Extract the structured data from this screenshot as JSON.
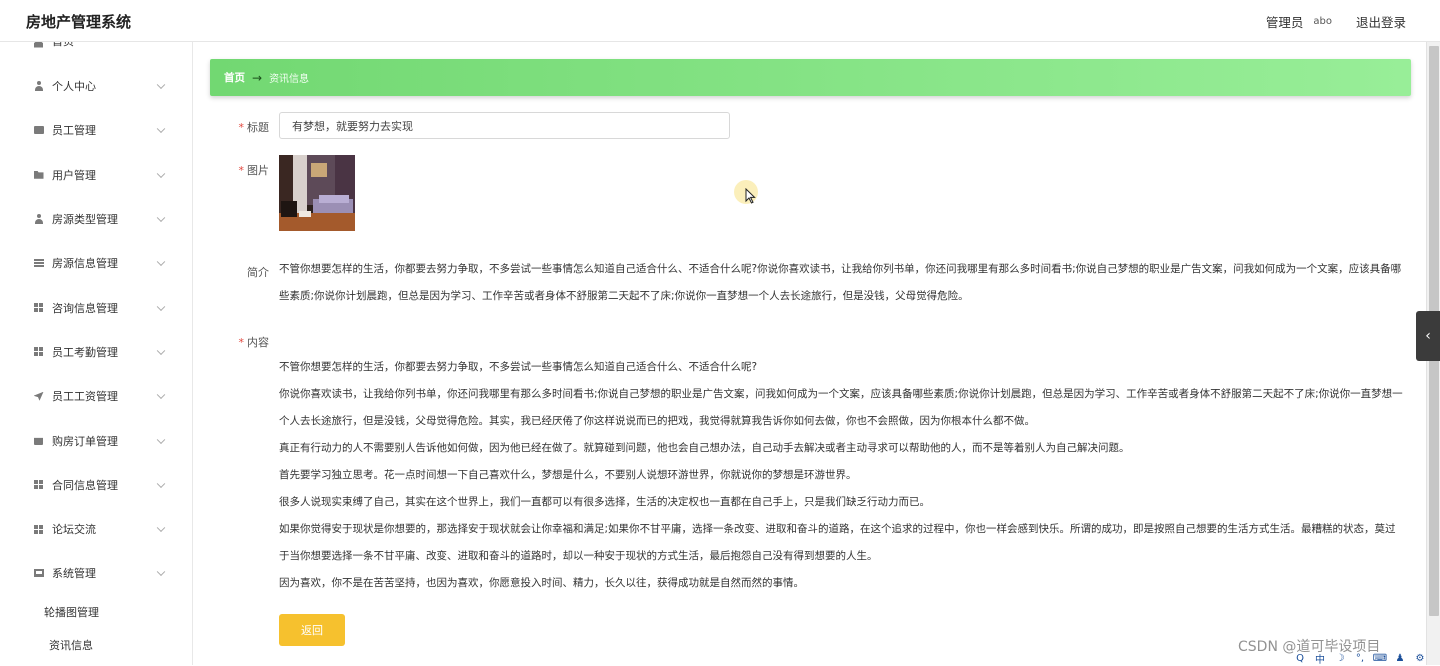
{
  "header": {
    "app_title": "房地产管理系统",
    "role": "管理员",
    "username": "abo",
    "logout_label": "退出登录"
  },
  "sidebar": {
    "items": [
      {
        "label": "首页",
        "icon": "home-icon"
      },
      {
        "label": "个人中心",
        "icon": "user-icon"
      },
      {
        "label": "员工管理",
        "icon": "chat-icon"
      },
      {
        "label": "用户管理",
        "icon": "folder-icon"
      },
      {
        "label": "房源类型管理",
        "icon": "user-icon"
      },
      {
        "label": "房源信息管理",
        "icon": "list-icon"
      },
      {
        "label": "咨询信息管理",
        "icon": "grid-icon"
      },
      {
        "label": "员工考勤管理",
        "icon": "grid-icon"
      },
      {
        "label": "员工工资管理",
        "icon": "send-icon"
      },
      {
        "label": "购房订单管理",
        "icon": "bag-icon"
      },
      {
        "label": "合同信息管理",
        "icon": "grid-icon"
      },
      {
        "label": "论坛交流",
        "icon": "grid-icon"
      },
      {
        "label": "系统管理",
        "icon": "monitor-icon"
      }
    ],
    "sub_items": [
      "轮播图管理",
      "资讯信息"
    ]
  },
  "breadcrumb": {
    "home": "首页",
    "arrow": "→",
    "current": "资讯信息"
  },
  "form": {
    "title_label": "标题",
    "title_value": "有梦想，就要努力去实现",
    "image_label": "图片",
    "intro_label": "简介",
    "intro_text": "不管你想要怎样的生活，你都要去努力争取，不多尝试一些事情怎么知道自己适合什么、不适合什么呢?你说你喜欢读书，让我给你列书单，你还问我哪里有那么多时间看书;你说自己梦想的职业是广告文案，问我如何成为一个文案，应该具备哪些素质;你说你计划晨跑，但总是因为学习、工作辛苦或者身体不舒服第二天起不了床;你说你一直梦想一个人去长途旅行，但是没钱，父母觉得危险。",
    "content_label": "内容",
    "content_paragraphs": [
      "不管你想要怎样的生活，你都要去努力争取，不多尝试一些事情怎么知道自己适合什么、不适合什么呢?",
      "你说你喜欢读书，让我给你列书单，你还问我哪里有那么多时间看书;你说自己梦想的职业是广告文案，问我如何成为一个文案，应该具备哪些素质;你说你计划晨跑，但总是因为学习、工作辛苦或者身体不舒服第二天起不了床;你说你一直梦想一个人去长途旅行，但是没钱，父母觉得危险。其实，我已经厌倦了你这样说说而已的把戏，我觉得就算我告诉你如何去做，你也不会照做，因为你根本什么都不做。",
      "真正有行动力的人不需要别人告诉他如何做，因为他已经在做了。就算碰到问题，他也会自己想办法，自己动手去解决或者主动寻求可以帮助他的人，而不是等着别人为自己解决问题。",
      "首先要学习独立思考。花一点时间想一下自己喜欢什么，梦想是什么，不要别人说想环游世界，你就说你的梦想是环游世界。",
      "很多人说现实束缚了自己，其实在这个世界上，我们一直都可以有很多选择，生活的决定权也一直都在自己手上，只是我们缺乏行动力而已。",
      "如果你觉得安于现状是你想要的，那选择安于现状就会让你幸福和满足;如果你不甘平庸，选择一条改变、进取和奋斗的道路，在这个追求的过程中，你也一样会感到快乐。所谓的成功，即是按照自己想要的生活方式生活。最糟糕的状态，莫过于当你想要选择一条不甘平庸、改变、进取和奋斗的道路时，却以一种安于现状的方式生活，最后抱怨自己没有得到想要的人生。",
      "因为喜欢，你不是在苦苦坚持，也因为喜欢，你愿意投入时间、精力，长久以往，获得成功就是自然而然的事情。"
    ],
    "back_label": "返回"
  },
  "overlay": {
    "side_tab_glyph": "‹",
    "watermark": "CSDN @道可毕设项目",
    "tray_glyphs": [
      "Q",
      "中",
      "☽",
      "°,",
      "⌨",
      "♟",
      "⚙"
    ]
  },
  "colors": {
    "breadcrumb_start": "#72d872",
    "breadcrumb_end": "#98ee98",
    "back_button": "#f6c12e",
    "required_star": "#e2473e"
  }
}
